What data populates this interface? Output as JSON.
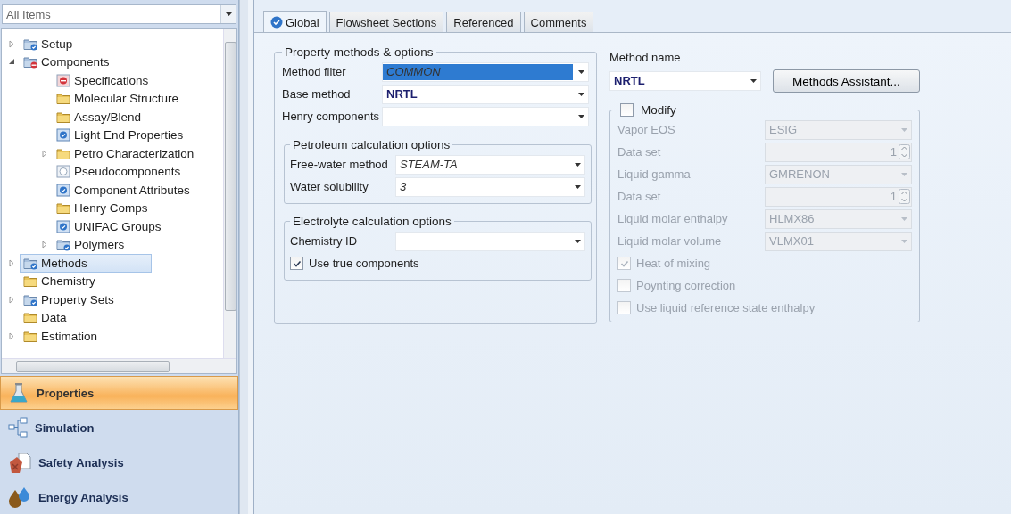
{
  "navigator": {
    "filter": "All Items",
    "tree": [
      {
        "label": "Setup",
        "kind": "folder-check",
        "expanded": false,
        "selected": false
      },
      {
        "label": "Components",
        "kind": "folder-error",
        "expanded": true,
        "selected": false,
        "children": [
          {
            "label": "Specifications",
            "kind": "form-error",
            "selected": false
          },
          {
            "label": "Molecular Structure",
            "kind": "folder",
            "selected": false
          },
          {
            "label": "Assay/Blend",
            "kind": "folder",
            "selected": false
          },
          {
            "label": "Light End Properties",
            "kind": "form-check",
            "selected": false
          },
          {
            "label": "Petro Characterization",
            "kind": "folder",
            "expanded": false,
            "selected": false
          },
          {
            "label": "Pseudocomponents",
            "kind": "form-empty",
            "selected": false
          },
          {
            "label": "Component Attributes",
            "kind": "form-check",
            "selected": false
          },
          {
            "label": "Henry Comps",
            "kind": "folder",
            "selected": false
          },
          {
            "label": "UNIFAC Groups",
            "kind": "form-check",
            "selected": false
          },
          {
            "label": "Polymers",
            "kind": "folder-check",
            "expanded": false,
            "selected": false
          }
        ]
      },
      {
        "label": "Methods",
        "kind": "folder-check",
        "expanded": false,
        "selected": true
      },
      {
        "label": "Chemistry",
        "kind": "folder",
        "selected": false
      },
      {
        "label": "Property Sets",
        "kind": "folder-check",
        "expanded": false,
        "selected": false
      },
      {
        "label": "Data",
        "kind": "folder",
        "selected": false
      },
      {
        "label": "Estimation",
        "kind": "folder",
        "expanded": false,
        "selected": false
      }
    ],
    "sections": [
      {
        "label": "Properties",
        "kind": "flask",
        "selected": true
      },
      {
        "label": "Simulation",
        "kind": "flowsheet",
        "selected": false
      },
      {
        "label": "Safety Analysis",
        "kind": "safety",
        "selected": false
      },
      {
        "label": "Energy Analysis",
        "kind": "energy",
        "selected": false
      }
    ]
  },
  "tabs": [
    {
      "label": "Global",
      "kind": "check",
      "selected": true
    },
    {
      "label": "Flowsheet Sections",
      "kind": "plain",
      "selected": false
    },
    {
      "label": "Referenced",
      "kind": "plain",
      "selected": false
    },
    {
      "label": "Comments",
      "kind": "plain",
      "selected": false
    }
  ],
  "property_methods": {
    "title": "Property methods & options",
    "rows": [
      {
        "kind": "combo",
        "label": "Method filter",
        "value": "COMMON",
        "default": true,
        "selected": true
      },
      {
        "kind": "combo",
        "label": "Base method",
        "value": "NRTL",
        "default": false,
        "selected": false
      },
      {
        "kind": "combo",
        "label": "Henry components"
      }
    ],
    "groups": [
      {
        "title": "Petroleum calculation options",
        "rows": [
          {
            "kind": "combo",
            "label": "Free-water method",
            "value": "STEAM-TA",
            "default": true,
            "selected": false
          },
          {
            "kind": "combo",
            "label": "Water solubility",
            "value": "3",
            "default": true,
            "selected": false
          }
        ]
      },
      {
        "title": "Electrolyte calculation options",
        "rows": [
          {
            "kind": "combo",
            "label": "Chemistry ID"
          },
          {
            "kind": "checkbox",
            "label": "Use true components",
            "checked": true,
            "disabled": false
          }
        ]
      }
    ]
  },
  "method_name": {
    "label": "Method name",
    "value": "NRTL",
    "default": false,
    "button": "Methods Assistant..."
  },
  "modify": {
    "label": "Modify",
    "checked": false,
    "rows": [
      {
        "kind": "combo",
        "label": "Vapor EOS",
        "value": "ESIG",
        "disabled": true
      },
      {
        "kind": "spin",
        "label": "Data set",
        "value": "1",
        "disabled": true
      },
      {
        "kind": "combo",
        "label": "Liquid gamma",
        "value": "GMRENON",
        "disabled": true
      },
      {
        "kind": "spin",
        "label": "Data set",
        "value": "1",
        "disabled": true
      },
      {
        "kind": "combo",
        "label": "Liquid molar enthalpy",
        "value": "HLMX86",
        "disabled": true
      },
      {
        "kind": "combo",
        "label": "Liquid molar volume",
        "value": "VLMX01",
        "disabled": true
      },
      {
        "kind": "checkbox",
        "label": "Heat of mixing",
        "checked": true,
        "disabled": true
      },
      {
        "kind": "checkbox",
        "label": "Poynting correction",
        "checked": false,
        "disabled": true
      },
      {
        "kind": "checkbox",
        "label": "Use liquid reference state enthalpy",
        "checked": false,
        "disabled": true
      }
    ]
  }
}
